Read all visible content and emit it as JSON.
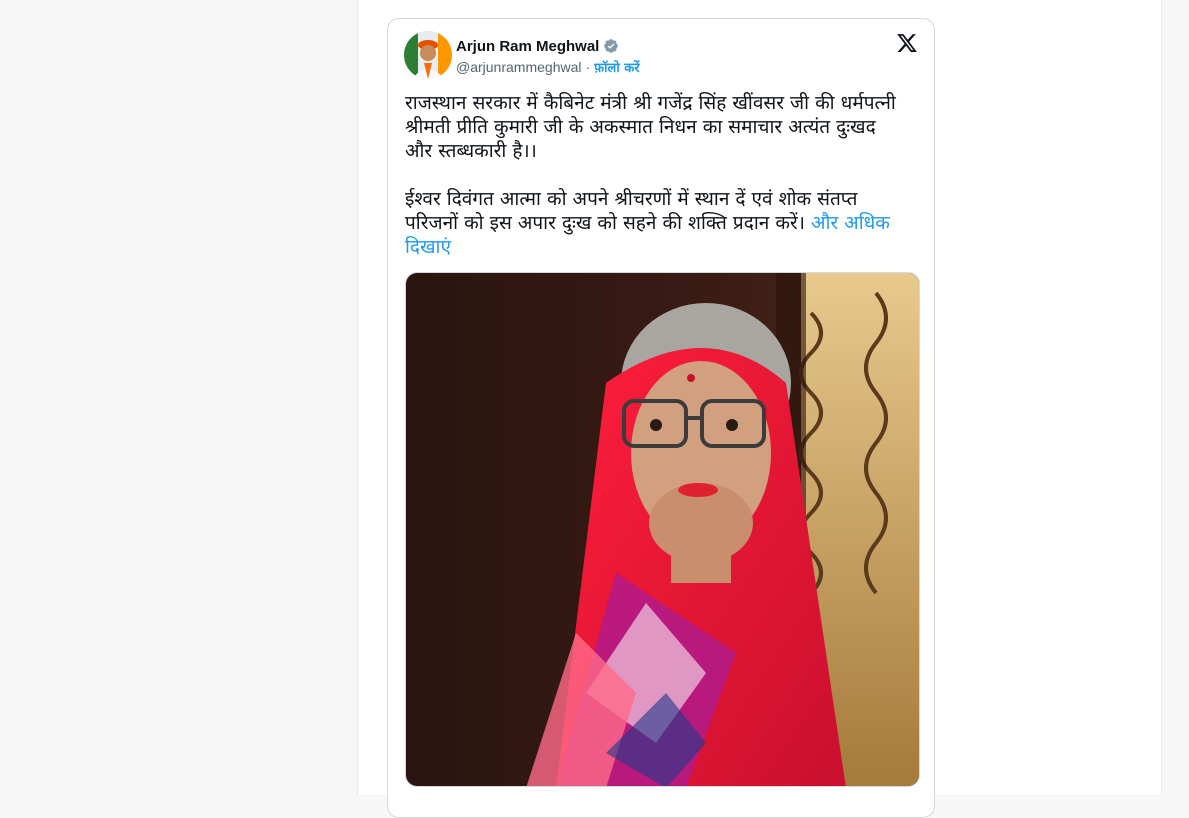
{
  "tweet": {
    "author_name": "Arjun Ram Meghwal",
    "handle": "@arjunrammeghwal",
    "separator": "·",
    "follow_label": "फ़ॉलो करें",
    "text": "राजस्थान सरकार में कैबिनेट मंत्री श्री गजेंद्र सिंह खींवसर जी की धर्मपत्नी श्रीमती प्रीति कुमारी जी के अकस्मात निधन का समाचार अत्यंत दुःखद और स्तब्धकारी है।।\n\nईश्वर दिवंगत आत्मा को अपने श्रीचरणों में स्थान दें एवं शोक संतप्त परिजनों को इस अपार दुःख को सहने की शक्ति प्रदान करें।",
    "show_more_label": "और अधिक दिखाएं",
    "verified_icon": "verified-badge-icon",
    "platform_icon": "x-logo-icon"
  },
  "colors": {
    "link": "#1d9bf0",
    "text": "#0f1419",
    "muted": "#536471",
    "border": "#cfd9de"
  }
}
